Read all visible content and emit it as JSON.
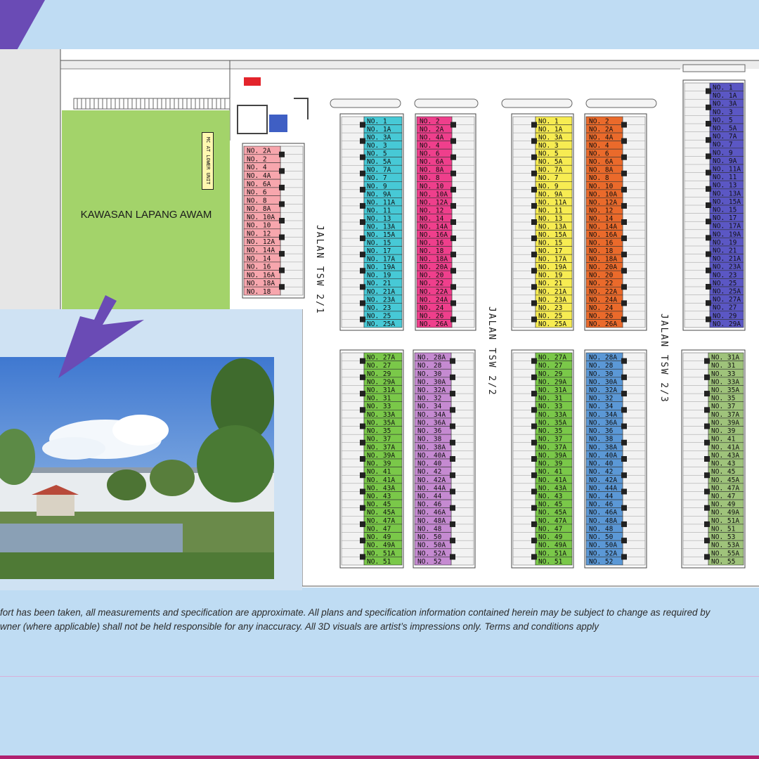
{
  "park": {
    "label": "KAWASAN LAPANG AWAM"
  },
  "mc_label": "MC AT LOWER UNIT",
  "streets": [
    "JALAN TSW 2/1",
    "JALAN TSW 2/2",
    "JALAN TSW 2/3"
  ],
  "disclaimer": {
    "line1": "fort has been taken, all measurements and specification are approximate. All plans and specification information contained herein may be subject to change as required by",
    "line2": "wner (where applicable) shall not be held responsible for any inaccuracy. All 3D visuals are artist’s impressions only. Terms and conditions apply"
  },
  "colors": {
    "background": "#bfdcf3",
    "accent_purple": "#6a4bb5",
    "park_green": "#a3d36a",
    "pink_light": "#f7a6ad",
    "cyan": "#47c9d6",
    "magenta": "#ef3f8c",
    "yellow": "#f7ec52",
    "orange": "#ea6a2b",
    "blue_purple": "#5b57c4",
    "green": "#7ac849",
    "lilac": "#c58ad1",
    "sky_blue": "#5b98d6",
    "sage": "#9fc37b",
    "magenta_bar": "#b0206f"
  },
  "blocks": [
    {
      "color": "pink_light",
      "units": [
        "NO. 2A",
        "NO. 2",
        "NO. 4",
        "NO. 4A",
        "NO. 6A",
        "NO. 6",
        "NO. 8",
        "NO. 8A",
        "NO. 10A",
        "NO. 10",
        "NO. 12",
        "NO. 12A",
        "NO. 14A",
        "NO. 14",
        "NO. 16",
        "NO. 16A",
        "NO. 18A",
        "NO. 18"
      ]
    },
    {
      "color": "cyan",
      "units": [
        "NO. 1",
        "NO. 1A",
        "NO. 3A",
        "NO. 3",
        "NO. 5",
        "NO. 5A",
        "NO. 7A",
        "NO. 7",
        "NO. 9",
        "NO. 9A",
        "NO. 11A",
        "NO. 11",
        "NO. 13",
        "NO. 13A",
        "NO. 15A",
        "NO. 15",
        "NO. 17",
        "NO. 17A",
        "NO. 19A",
        "NO. 19",
        "NO. 21",
        "NO. 21A",
        "NO. 23A",
        "NO. 23",
        "NO. 25",
        "NO. 25A"
      ]
    },
    {
      "color": "magenta",
      "units": [
        "NO. 2",
        "NO. 2A",
        "NO. 4A",
        "NO. 4",
        "NO. 6",
        "NO. 6A",
        "NO. 8A",
        "NO. 8",
        "NO. 10",
        "NO. 10A",
        "NO. 12A",
        "NO. 12",
        "NO. 14",
        "NO. 14A",
        "NO. 16A",
        "NO. 16",
        "NO. 18",
        "NO. 18A",
        "NO. 20A",
        "NO. 20",
        "NO. 22",
        "NO. 22A",
        "NO. 24A",
        "NO. 24",
        "NO. 26",
        "NO. 26A"
      ]
    },
    {
      "color": "yellow",
      "units": [
        "NO. 1",
        "NO. 1A",
        "NO. 3A",
        "NO. 3",
        "NO. 5",
        "NO. 5A",
        "NO. 7A",
        "NO. 7",
        "NO. 9",
        "NO. 9A",
        "NO. 11A",
        "NO. 11",
        "NO. 13",
        "NO. 13A",
        "NO. 15A",
        "NO. 15",
        "NO. 17",
        "NO. 17A",
        "NO. 19A",
        "NO. 19",
        "NO. 21",
        "NO. 21A",
        "NO. 23A",
        "NO. 23",
        "NO. 25",
        "NO. 25A"
      ]
    },
    {
      "color": "orange",
      "units": [
        "NO. 2",
        "NO. 2A",
        "NO. 4A",
        "NO. 4",
        "NO. 6",
        "NO. 6A",
        "NO. 8A",
        "NO. 8",
        "NO. 10",
        "NO. 10A",
        "NO. 12A",
        "NO. 12",
        "NO. 14",
        "NO. 14A",
        "NO. 16A",
        "NO. 16",
        "NO. 18",
        "NO. 18A",
        "NO. 20A",
        "NO. 20",
        "NO. 22",
        "NO. 22A",
        "NO. 24A",
        "NO. 24",
        "NO. 26",
        "NO. 26A"
      ]
    },
    {
      "color": "blue_purple",
      "units": [
        "NO. 1",
        "NO. 1A",
        "NO. 3A",
        "NO. 3",
        "NO. 5",
        "NO. 5A",
        "NO. 7A",
        "NO. 7",
        "NO. 9",
        "NO. 9A",
        "NO. 11A",
        "NO. 11",
        "NO. 13",
        "NO. 13A",
        "NO. 15A",
        "NO. 15",
        "NO. 17",
        "NO. 17A",
        "NO. 19A",
        "NO. 19",
        "NO. 21",
        "NO. 21A",
        "NO. 23A",
        "NO. 23",
        "NO. 25",
        "NO. 25A",
        "NO. 27A",
        "NO. 27",
        "NO. 29",
        "NO. 29A"
      ]
    },
    {
      "color": "green",
      "units": [
        "NO. 27A",
        "NO. 27",
        "NO. 29",
        "NO. 29A",
        "NO. 31A",
        "NO. 31",
        "NO. 33",
        "NO. 33A",
        "NO. 35A",
        "NO. 35",
        "NO. 37",
        "NO. 37A",
        "NO. 39A",
        "NO. 39",
        "NO. 41",
        "NO. 41A",
        "NO. 43A",
        "NO. 43",
        "NO. 45",
        "NO. 45A",
        "NO. 47A",
        "NO. 47",
        "NO. 49",
        "NO. 49A",
        "NO. 51A",
        "NO. 51"
      ]
    },
    {
      "color": "lilac",
      "units": [
        "NO. 28A",
        "NO. 28",
        "NO. 30",
        "NO. 30A",
        "NO. 32A",
        "NO. 32",
        "NO. 34",
        "NO. 34A",
        "NO. 36A",
        "NO. 36",
        "NO. 38",
        "NO. 38A",
        "NO. 40A",
        "NO. 40",
        "NO. 42",
        "NO. 42A",
        "NO. 44A",
        "NO. 44",
        "NO. 46",
        "NO. 46A",
        "NO. 48A",
        "NO. 48",
        "NO. 50",
        "NO. 50A",
        "NO. 52A",
        "NO. 52"
      ]
    },
    {
      "color": "green",
      "units": [
        "NO. 27A",
        "NO. 27",
        "NO. 29",
        "NO. 29A",
        "NO. 31A",
        "NO. 31",
        "NO. 33",
        "NO. 33A",
        "NO. 35A",
        "NO. 35",
        "NO. 37",
        "NO. 37A",
        "NO. 39A",
        "NO. 39",
        "NO. 41",
        "NO. 41A",
        "NO. 43A",
        "NO. 43",
        "NO. 45",
        "NO. 45A",
        "NO. 47A",
        "NO. 47",
        "NO. 49",
        "NO. 49A",
        "NO. 51A",
        "NO. 51"
      ]
    },
    {
      "color": "sky_blue",
      "units": [
        "NO. 28A",
        "NO. 28",
        "NO. 30",
        "NO. 30A",
        "NO. 32A",
        "NO. 32",
        "NO. 34",
        "NO. 34A",
        "NO. 36A",
        "NO. 36",
        "NO. 38",
        "NO. 38A",
        "NO. 40A",
        "NO. 40",
        "NO. 42",
        "NO. 42A",
        "NO. 44A",
        "NO. 44",
        "NO. 46",
        "NO. 46A",
        "NO. 48A",
        "NO. 48",
        "NO. 50",
        "NO. 50A",
        "NO. 52A",
        "NO. 52"
      ]
    },
    {
      "color": "sage",
      "units": [
        "NO. 31A",
        "NO. 31",
        "NO. 33",
        "NO. 33A",
        "NO. 35A",
        "NO. 35",
        "NO. 37",
        "NO. 37A",
        "NO. 39A",
        "NO. 39",
        "NO. 41",
        "NO. 41A",
        "NO. 43A",
        "NO. 43",
        "NO. 45",
        "NO. 45A",
        "NO. 47A",
        "NO. 47",
        "NO. 49",
        "NO. 49A",
        "NO. 51A",
        "NO. 51",
        "NO. 53",
        "NO. 53A",
        "NO. 55A",
        "NO. 55"
      ]
    }
  ]
}
